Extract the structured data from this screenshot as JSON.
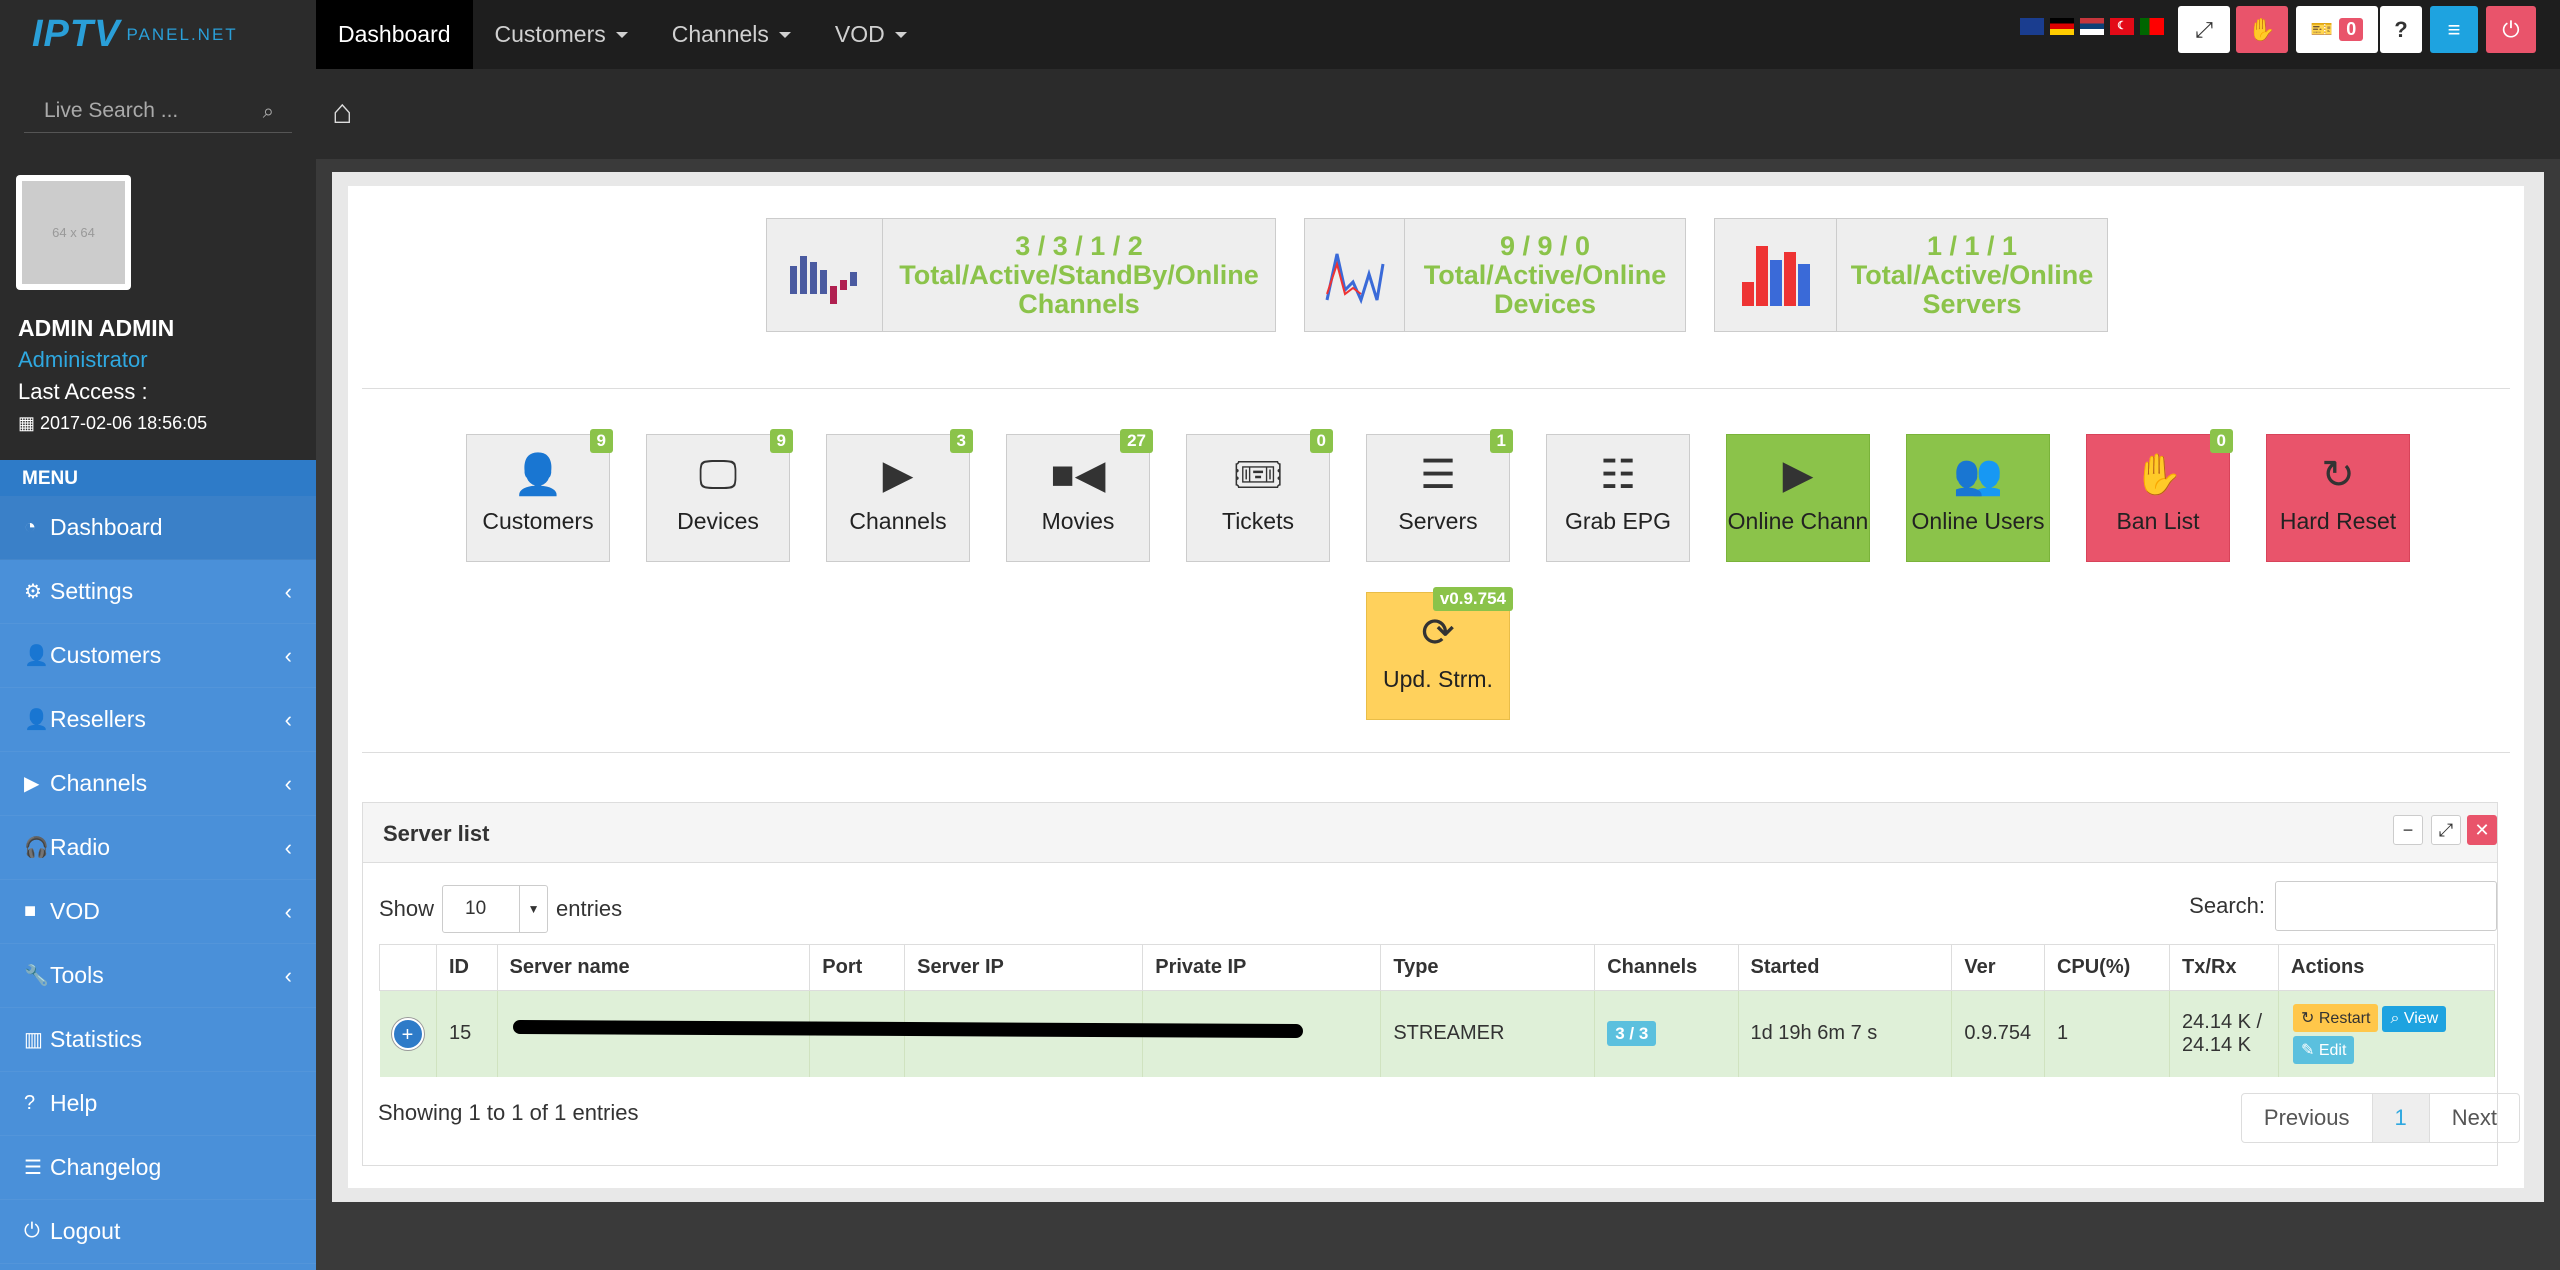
{
  "brand": {
    "logo_main": "IPTV",
    "logo_sub": "PANEL.NET"
  },
  "nav": {
    "items": [
      {
        "label": "Dashboard",
        "active": true
      },
      {
        "label": "Customers"
      },
      {
        "label": "Channels"
      },
      {
        "label": "VOD"
      }
    ]
  },
  "toolbar": {
    "tickets_count": "0",
    "help": "?",
    "flags": [
      "gb-flag",
      "de-flag",
      "rs-flag",
      "tr-flag",
      "pt-flag"
    ],
    "colors": {
      "red": "#e9546b",
      "cyan": "#1ea3e0",
      "green": "#8bc34a"
    }
  },
  "search": {
    "placeholder": "Live Search ..."
  },
  "profile": {
    "avatar_text": "64 x 64",
    "name": "ADMIN ADMIN",
    "role": "Administrator",
    "last_access_label": "Last Access :",
    "last_access": "2017-02-06 18:56:05"
  },
  "menu": {
    "header": "MENU",
    "items": [
      {
        "label": "Dashboard",
        "icon": "dashboard-icon",
        "active": true
      },
      {
        "label": "Settings",
        "icon": "gear-icon",
        "chevron": true
      },
      {
        "label": "Customers",
        "icon": "user-icon",
        "chevron": true
      },
      {
        "label": "Resellers",
        "icon": "user-icon",
        "chevron": true
      },
      {
        "label": "Channels",
        "icon": "play-icon",
        "chevron": true
      },
      {
        "label": "Radio",
        "icon": "headphones-icon",
        "chevron": true
      },
      {
        "label": "VOD",
        "icon": "video-icon",
        "chevron": true
      },
      {
        "label": "Tools",
        "icon": "wrench-icon",
        "chevron": true
      },
      {
        "label": "Statistics",
        "icon": "bar-chart-icon"
      },
      {
        "label": "Help",
        "icon": "question-icon"
      },
      {
        "label": "Changelog",
        "icon": "list-icon"
      },
      {
        "label": "Logout",
        "icon": "power-icon"
      }
    ]
  },
  "stats": [
    {
      "numbers": "3 / 3 / 1 / 2",
      "line1": "Total/Active/StandBy/Online",
      "line2": "Channels"
    },
    {
      "numbers": "9 / 9 / 0",
      "line1": "Total/Active/Online",
      "line2": "Devices"
    },
    {
      "numbers": "1 / 1 / 1",
      "line1": "Total/Active/Online",
      "line2": "Servers"
    }
  ],
  "tiles": [
    {
      "label": "Customers",
      "badge": "9",
      "icon": "user-icon"
    },
    {
      "label": "Devices",
      "badge": "9",
      "icon": "monitor-icon"
    },
    {
      "label": "Channels",
      "badge": "3",
      "icon": "play-icon"
    },
    {
      "label": "Movies",
      "badge": "27",
      "icon": "video-camera-icon"
    },
    {
      "label": "Tickets",
      "badge": "0",
      "icon": "ticket-icon"
    },
    {
      "label": "Servers",
      "badge": "1",
      "icon": "server-icon"
    },
    {
      "label": "Grab EPG",
      "icon": "list-icon"
    },
    {
      "label": "Online Chann",
      "icon": "play-icon"
    },
    {
      "label": "Online Users",
      "icon": "users-icon"
    },
    {
      "label": "Ban List",
      "badge": "0",
      "icon": "hand-icon"
    },
    {
      "label": "Hard Reset",
      "icon": "reload-icon"
    },
    {
      "label": "Upd. Strm.",
      "badge": "v0.9.754",
      "icon": "refresh-icon"
    }
  ],
  "server_list": {
    "title": "Server list",
    "show_label": "Show",
    "entries_value": "10",
    "entries_label": "entries",
    "search_label": "Search:",
    "columns": [
      "ID",
      "Server name",
      "Port",
      "Server IP",
      "Private IP",
      "Type",
      "Channels",
      "Started",
      "Ver",
      "CPU(%)",
      "Tx/Rx",
      "Actions"
    ],
    "rows": [
      {
        "id": "15",
        "type": "STREAMER",
        "channels": "3 / 3",
        "started": "1d 19h 6m 7 s",
        "ver": "0.9.754",
        "cpu": "1",
        "txrx_1": "24.14 K /",
        "txrx_2": "24.14 K",
        "restart": "Restart",
        "view": "View",
        "edit": "Edit"
      }
    ],
    "info": "Showing 1 to 1 of 1 entries",
    "pager": {
      "prev": "Previous",
      "page": "1",
      "next": "Next"
    }
  }
}
